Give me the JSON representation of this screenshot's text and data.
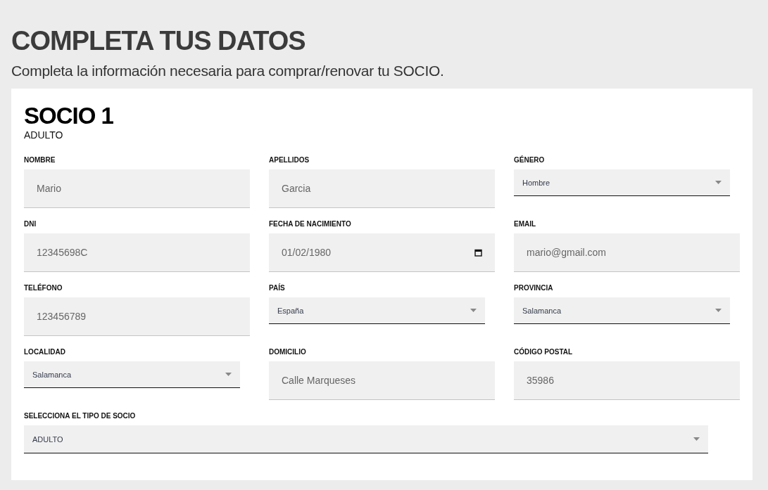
{
  "header": {
    "title": "COMPLETA TUS DATOS",
    "subtitle": "Completa la información necesaria para comprar/renovar tu SOCIO."
  },
  "card": {
    "title": "SOCIO 1",
    "subtitle": "ADULTO",
    "fields": [
      {
        "label": "NOMBRE",
        "kind": "text",
        "value": "Mario"
      },
      {
        "label": "APELLIDOS",
        "kind": "text",
        "value": "Garcia"
      },
      {
        "label": "GÉNERO",
        "kind": "select",
        "value": "Hombre"
      },
      {
        "label": "DNI",
        "kind": "text",
        "value": "12345698C"
      },
      {
        "label": "FECHA DE NACIMIENTO",
        "kind": "date",
        "value": "01/02/1980"
      },
      {
        "label": "EMAIL",
        "kind": "text",
        "value": "mario@gmail.com"
      },
      {
        "label": "TELÉFONO",
        "kind": "text",
        "value": "123456789"
      },
      {
        "label": "PAÍS",
        "kind": "select",
        "value": "España"
      },
      {
        "label": "PROVINCIA",
        "kind": "select",
        "value": "Salamanca"
      },
      {
        "label": "LOCALIDAD",
        "kind": "select",
        "value": "Salamanca"
      },
      {
        "label": "DOMICILIO",
        "kind": "text",
        "value": "Calle Marqueses"
      },
      {
        "label": "CÓDIGO POSTAL",
        "kind": "text",
        "value": "35986"
      },
      {
        "label": "SELECCIONA EL TIPO DE SOCIO",
        "kind": "wide-select",
        "value": "ADULTO"
      }
    ]
  }
}
